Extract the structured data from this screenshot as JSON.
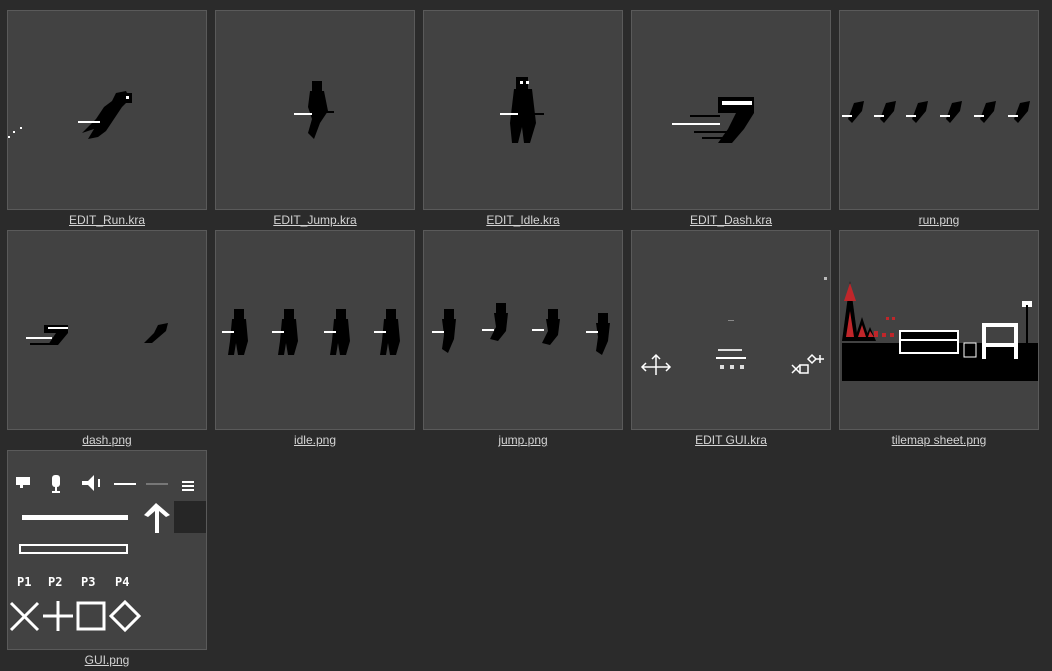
{
  "files": [
    {
      "name": "EDIT_Run.kra"
    },
    {
      "name": "EDIT_Jump.kra"
    },
    {
      "name": "EDIT_Idle.kra"
    },
    {
      "name": "EDIT_Dash.kra"
    },
    {
      "name": "run.png"
    },
    {
      "name": "dash.png"
    },
    {
      "name": "idle.png"
    },
    {
      "name": "jump.png"
    },
    {
      "name": "EDIT GUI.kra"
    },
    {
      "name": "tilemap sheet.png"
    },
    {
      "name": "GUI.png"
    }
  ],
  "gui_sprite_text": {
    "p1": "P1",
    "p2": "P2",
    "p3": "P3",
    "p4": "P4"
  },
  "colors": {
    "background": "#2b2b2b",
    "thumbnail": "#424242",
    "label": "#d4d4d4",
    "accent_red": "#c0262a"
  }
}
